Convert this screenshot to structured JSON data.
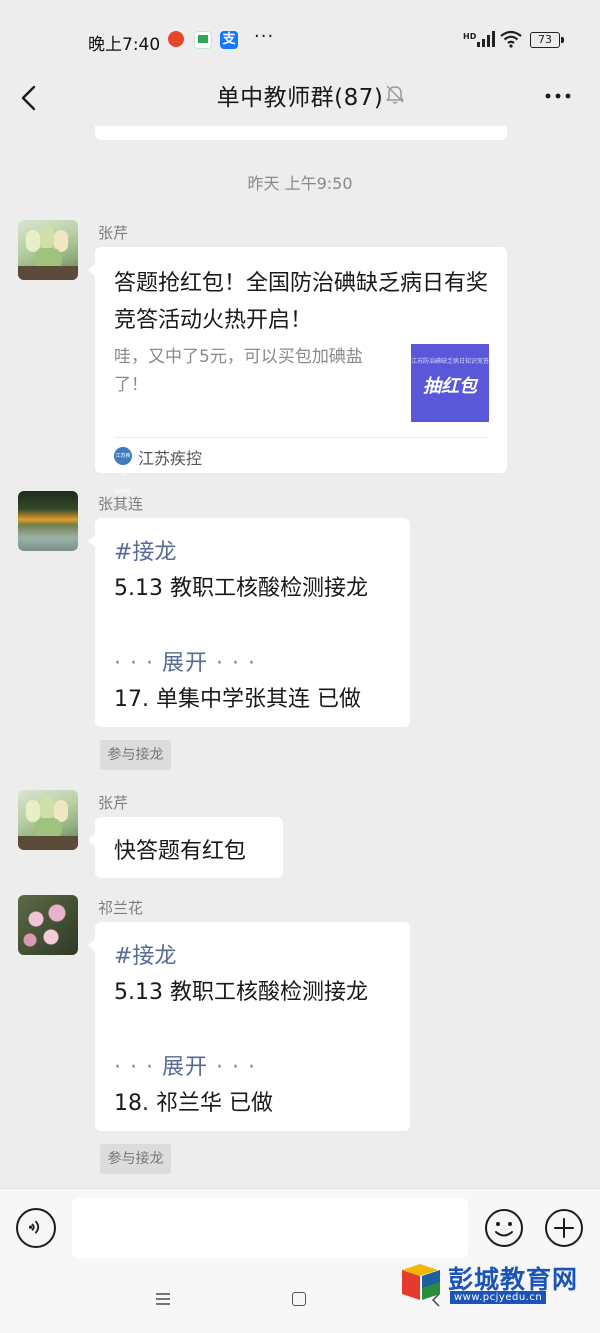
{
  "status_bar": {
    "time": "晚上7:40",
    "more": "···",
    "network": "HD",
    "battery": "73"
  },
  "header": {
    "title": "单中教师群(87)"
  },
  "chat": {
    "timestamp": "昨天 上午9:50",
    "messages": [
      {
        "sender": "张芹",
        "card": {
          "title": "答题抢红包！全国防治碘缺乏病日有奖竞答活动火热开启！",
          "description": "哇，又中了5元，可以买包加碘盐了！",
          "thumb_top": "江苏防治碘缺乏病日知识竞答",
          "thumb_main": "抽红包",
          "source_badge": "江苏疾控 JSCDC",
          "source": "江苏疾控"
        }
      },
      {
        "sender": "张其连",
        "jielong": {
          "tag": "#接龙",
          "subject": "5.13 教职工核酸检测接龙",
          "expand_dots_left": "· · · ",
          "expand": "展开",
          "expand_dots_right": " · · ·",
          "entry": "17. 单集中学张其连 已做"
        },
        "join_label": "参与接龙"
      },
      {
        "sender": "张芹",
        "text": "快答题有红包"
      },
      {
        "sender": "祁兰花",
        "jielong": {
          "tag": "#接龙",
          "subject": "5.13 教职工核酸检测接龙",
          "expand_dots_left": "· · · ",
          "expand": "展开",
          "expand_dots_right": " · · ·",
          "entry": "18. 祁兰华 已做"
        },
        "join_label": "参与接龙"
      }
    ]
  },
  "input": {
    "placeholder": ""
  },
  "watermark": {
    "title": "彭城教育网",
    "url": "www.pcjyedu.cn"
  },
  "colors": {
    "background": "#ededed",
    "bubble": "#ffffff",
    "link": "#576b95",
    "meta": "#8a8a8a",
    "watermark": "#1a54b8"
  },
  "icons": [
    "back-arrow-icon",
    "mute-bell-icon",
    "more-icon",
    "voice-icon",
    "emoji-icon",
    "plus-icon",
    "menu-icon",
    "home-icon",
    "back-icon"
  ]
}
